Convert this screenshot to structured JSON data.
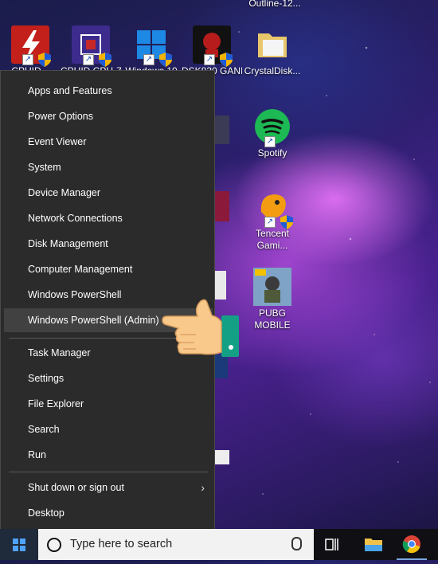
{
  "desktop": {
    "top_label": "Outline-12...",
    "icons": [
      {
        "label": "CPUID...",
        "color": "#c3201b"
      },
      {
        "label": "CPUID CPU-Z",
        "color": "#3d2b8e"
      },
      {
        "label": "Windows 10",
        "color": "#1e88e5"
      },
      {
        "label": "DSK830 GANI...",
        "color": "#b71c1c"
      },
      {
        "label": "CrystalDisk...",
        "color": "#e8c66b"
      },
      {
        "label": "Spotify",
        "color": "#1db954"
      },
      {
        "label": "Tencent Gami...",
        "color": "#f39c12"
      },
      {
        "label": "PUBG MOBILE",
        "color": "#6b8fb3"
      }
    ]
  },
  "context_menu": {
    "group1": [
      "Apps and Features",
      "Power Options",
      "Event Viewer",
      "System",
      "Device Manager",
      "Network Connections",
      "Disk Management",
      "Computer Management",
      "Windows PowerShell",
      "Windows PowerShell (Admin)"
    ],
    "group2": [
      "Task Manager",
      "Settings",
      "File Explorer",
      "Search",
      "Run"
    ],
    "group3": [
      "Shut down or sign out",
      "Desktop"
    ],
    "submenu_arrow": "›"
  },
  "taskbar": {
    "search_placeholder": "Type here to search"
  },
  "colors": {
    "menu_bg": "#2b2b2b",
    "menu_hover": "#414141",
    "taskbar_bg": "#0f0f14"
  }
}
